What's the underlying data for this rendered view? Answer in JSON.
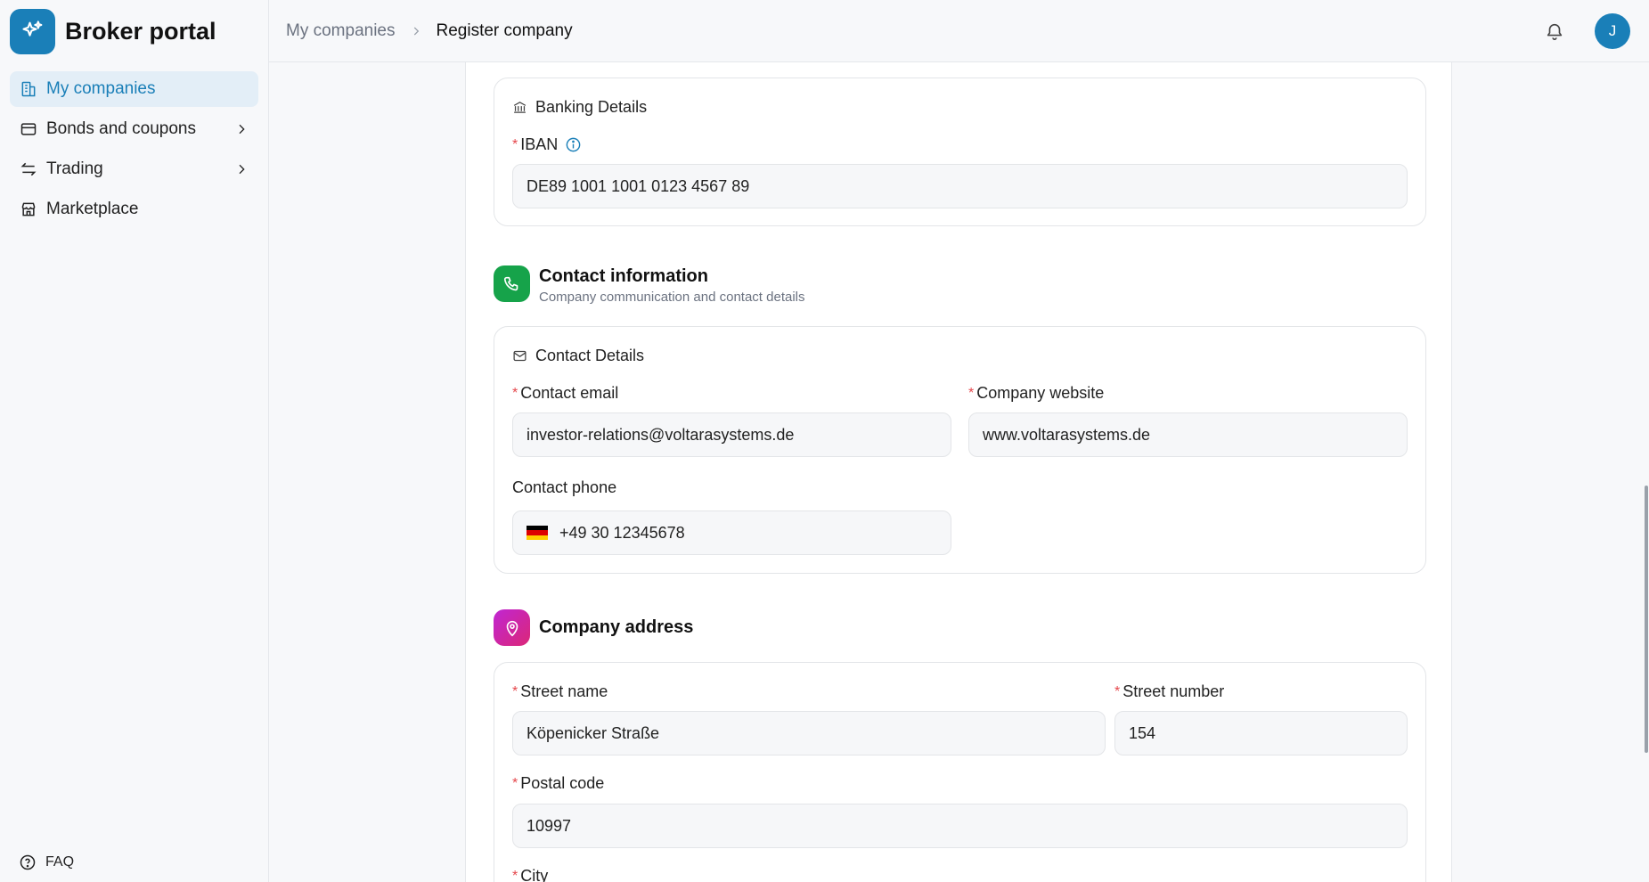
{
  "app": {
    "title": "Broker portal"
  },
  "sidebar": {
    "items": [
      {
        "label": "My companies",
        "icon": "building-icon",
        "active": true
      },
      {
        "label": "Bonds and coupons",
        "icon": "card-icon",
        "has_submenu": true
      },
      {
        "label": "Trading",
        "icon": "arrows-icon",
        "has_submenu": true
      },
      {
        "label": "Marketplace",
        "icon": "store-icon"
      }
    ],
    "faq_label": "FAQ"
  },
  "header": {
    "breadcrumb": {
      "parent": "My companies",
      "current": "Register company"
    },
    "avatar_initial": "J"
  },
  "banking": {
    "card_title": "Banking Details",
    "iban_label": "IBAN",
    "iban_value": "DE89 1001 1001 0123 4567 89"
  },
  "contact": {
    "section_title": "Contact information",
    "section_subtitle": "Company communication and contact details",
    "card_title": "Contact Details",
    "email_label": "Contact email",
    "email_value": "investor-relations@voltarasystems.de",
    "website_label": "Company website",
    "website_value": "www.voltarasystems.de",
    "phone_label": "Contact phone",
    "phone_value": "+49 30 12345678"
  },
  "address": {
    "section_title": "Company address",
    "street_name_label": "Street name",
    "street_name_value": "Köpenicker Straße",
    "street_number_label": "Street number",
    "street_number_value": "154",
    "postal_code_label": "Postal code",
    "postal_code_value": "10997",
    "city_label": "City"
  },
  "colors": {
    "accent": "#1a7fb8",
    "contact_icon_bg": "#16a34a",
    "address_icon_bg": "#c026d3",
    "required": "#e5484d"
  }
}
